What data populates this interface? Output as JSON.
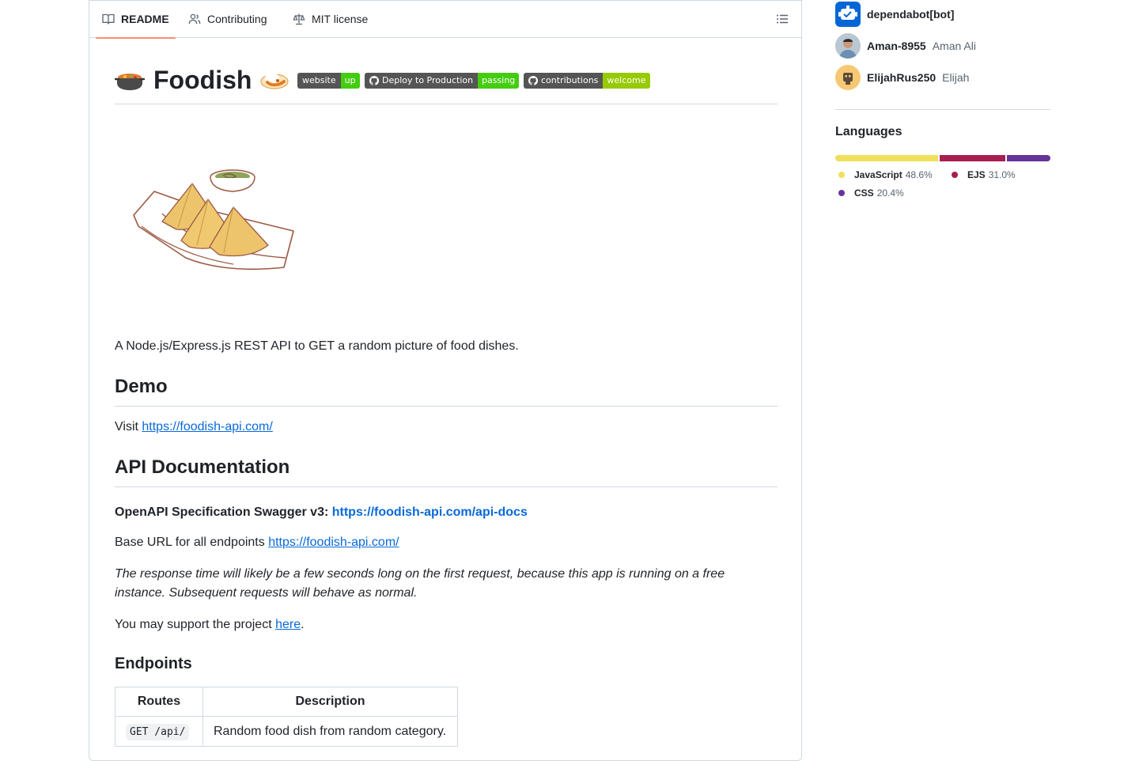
{
  "tabs": [
    {
      "label": "README",
      "icon": "book-icon",
      "active": true
    },
    {
      "label": "Contributing",
      "icon": "people-icon",
      "active": false
    },
    {
      "label": "MIT license",
      "icon": "law-icon",
      "active": false
    }
  ],
  "toc_icon": "list-unordered-icon",
  "readme": {
    "title": "Foodish",
    "badges": [
      {
        "left": "website",
        "right": "up",
        "color": "#4c1"
      },
      {
        "left": "Deploy to Production",
        "right": "passing",
        "color": "#4c1",
        "icon": "github-icon"
      },
      {
        "left": "contributions",
        "right": "welcome",
        "color": "#97ca00",
        "icon": "github-icon"
      }
    ],
    "description": "A Node.js/Express.js REST API to GET a random picture of food dishes.",
    "demo_heading": "Demo",
    "demo_prefix": "Visit ",
    "demo_link": "https://foodish-api.com/",
    "api_heading": "API Documentation",
    "openapi_label": "OpenAPI Specification Swagger v3: ",
    "openapi_link": "https://foodish-api.com/api-docs",
    "base_url_prefix": "Base URL for all endpoints ",
    "base_url_link": "https://foodish-api.com/",
    "note": "The response time will likely be a few seconds long on the first request, because this app is running on a free instance. Subsequent requests will behave as normal.",
    "support_prefix": "You may support the project ",
    "support_link": "here",
    "support_suffix": ".",
    "endpoints_heading": "Endpoints",
    "table": {
      "headers": [
        "Routes",
        "Description"
      ],
      "rows": [
        {
          "route": "GET /api/",
          "description": "Random food dish from random category."
        }
      ]
    }
  },
  "sidebar": {
    "contributors": [
      {
        "login": "dependabot[bot]",
        "name": "",
        "avatar": "dependabot-avatar"
      },
      {
        "login": "Aman-8955",
        "name": "Aman Ali",
        "avatar": "user-photo-avatar"
      },
      {
        "login": "ElijahRus250",
        "name": "Elijah",
        "avatar": "robot-avatar"
      }
    ],
    "languages_title": "Languages",
    "languages": [
      {
        "name": "JavaScript",
        "percent": "48.6%",
        "value": 48.6,
        "color": "#f1e05a"
      },
      {
        "name": "EJS",
        "percent": "31.0%",
        "value": 31.0,
        "color": "#a91e50"
      },
      {
        "name": "CSS",
        "percent": "20.4%",
        "value": 20.4,
        "color": "#663399"
      }
    ]
  }
}
